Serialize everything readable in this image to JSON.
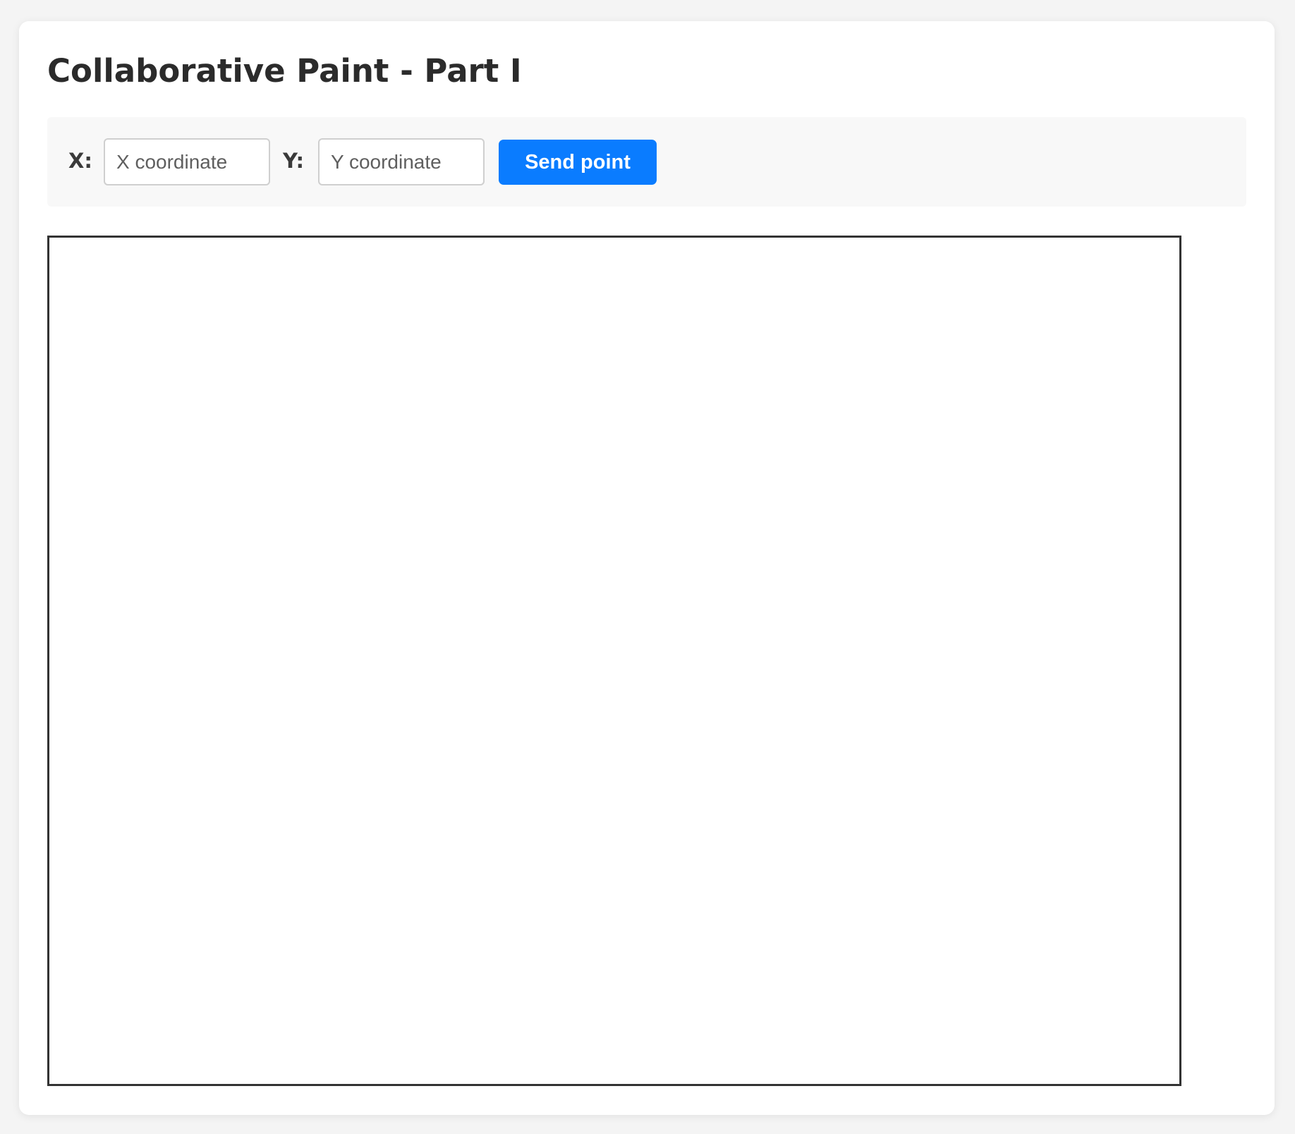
{
  "page": {
    "title": "Collaborative Paint - Part I"
  },
  "controls": {
    "x_label": "X:",
    "x_placeholder": "X coordinate",
    "x_value": "",
    "y_label": "Y:",
    "y_placeholder": "Y coordinate",
    "y_value": "",
    "send_label": "Send point"
  },
  "colors": {
    "accent": "#0a7cff",
    "canvas_border": "#333333",
    "page_background": "#f4f4f4",
    "card_background": "#ffffff",
    "toolbar_background": "#f8f8f8"
  },
  "canvas": {
    "points": []
  }
}
